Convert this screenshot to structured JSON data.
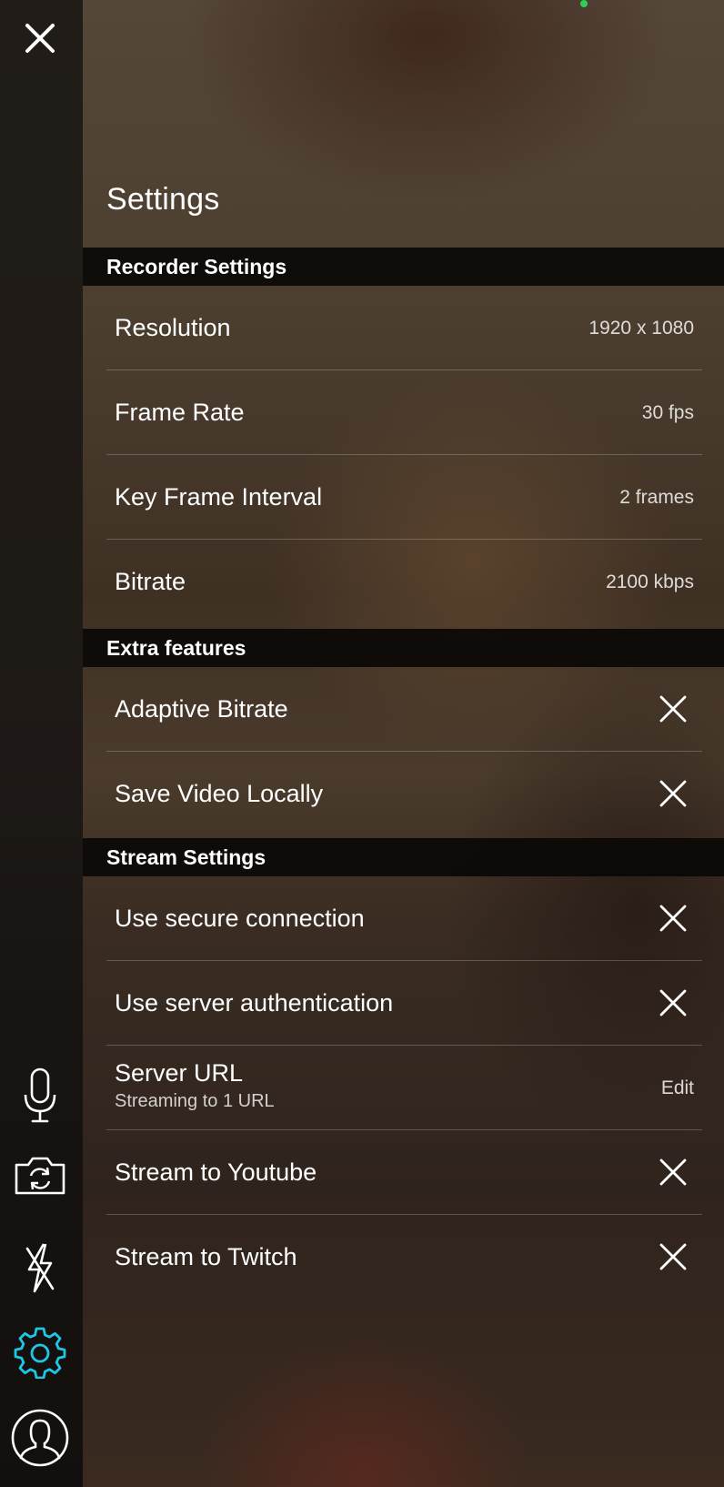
{
  "app": {
    "title": "Settings",
    "accent_color": "#1fc7e6",
    "status_color": "#2fcf55"
  },
  "sidebar": {
    "icons": [
      "close-icon",
      "microphone-icon",
      "camera-switch-icon",
      "flash-off-icon",
      "gear-icon",
      "profile-icon"
    ],
    "active_item": "gear-icon"
  },
  "sections": {
    "recorder": {
      "header": "Recorder Settings",
      "rows": [
        {
          "label": "Resolution",
          "value": "1920 x 1080"
        },
        {
          "label": "Frame Rate",
          "value": "30 fps"
        },
        {
          "label": "Key Frame Interval",
          "value": "2 frames"
        },
        {
          "label": "Bitrate",
          "value": "2100 kbps"
        }
      ]
    },
    "extra": {
      "header": "Extra features",
      "rows": [
        {
          "label": "Adaptive Bitrate",
          "state": "off",
          "icon": "close-icon"
        },
        {
          "label": "Save Video Locally",
          "state": "off",
          "icon": "close-icon"
        }
      ]
    },
    "stream": {
      "header": "Stream Settings",
      "rows": [
        {
          "label": "Use secure connection",
          "state": "off",
          "icon": "close-icon"
        },
        {
          "label": "Use server authentication",
          "state": "off",
          "icon": "close-icon"
        },
        {
          "label": "Server URL",
          "sublabel": "Streaming to 1 URL",
          "action": "Edit"
        },
        {
          "label": "Stream to Youtube",
          "state": "off",
          "icon": "close-icon"
        },
        {
          "label": "Stream to Twitch",
          "state": "off",
          "icon": "close-icon"
        }
      ]
    }
  }
}
